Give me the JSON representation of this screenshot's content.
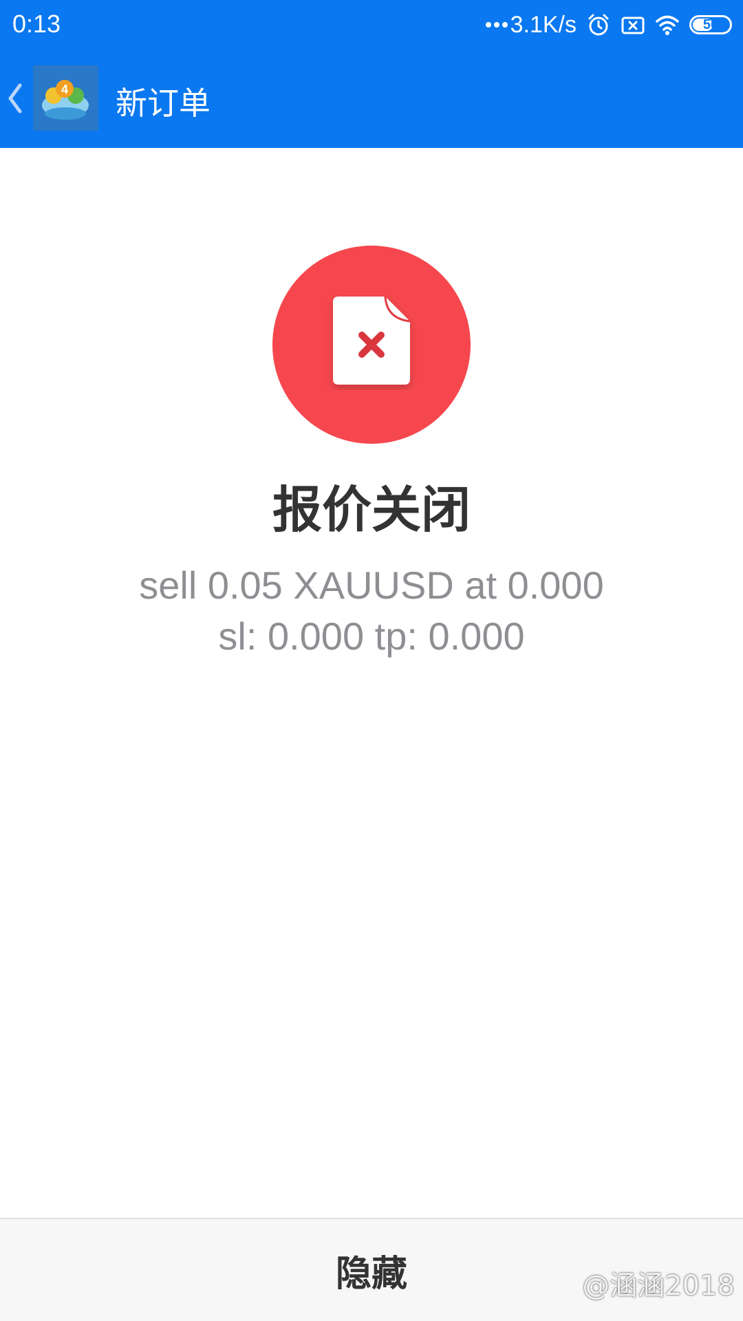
{
  "status_bar": {
    "time": "0:13",
    "net_speed": "3.1K/s",
    "battery_level": "56",
    "icons": [
      "alarm-icon",
      "no-sim-icon",
      "wifi-icon",
      "battery-icon"
    ]
  },
  "app_bar": {
    "title": "新订单",
    "back_icon": "chevron-left-icon",
    "logo_icon": "metatrader-4-logo"
  },
  "result": {
    "icon": "document-error-icon",
    "title": "报价关闭",
    "detail_line1": "sell 0.05 XAUUSD at 0.000",
    "detail_line2": "sl: 0.000 tp: 0.000"
  },
  "footer": {
    "hide_label": "隐藏"
  },
  "watermark": "@涵涵2018",
  "colors": {
    "header": "#0a78f0",
    "error": "#f6474e",
    "title_text": "#333333",
    "detail_text": "#8e8e93",
    "footer_bg": "#f7f7f7"
  }
}
